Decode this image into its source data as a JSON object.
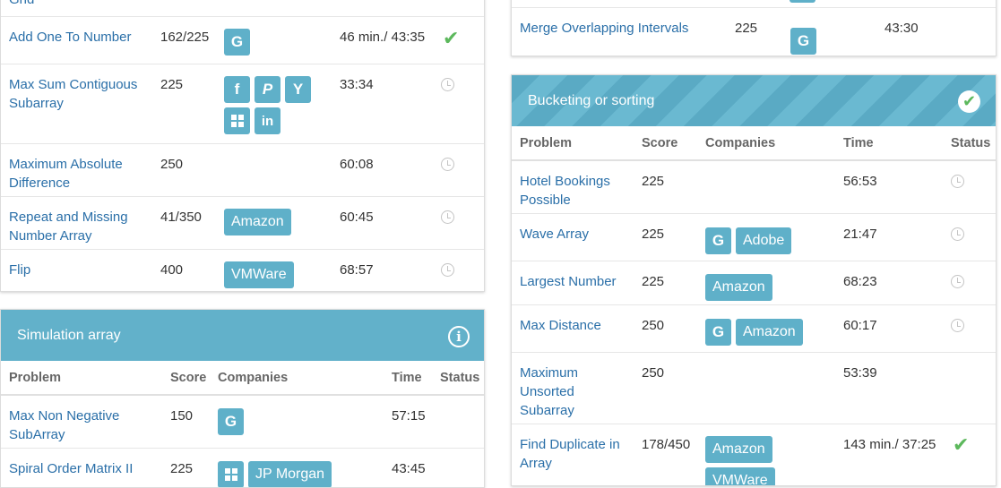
{
  "left_top": {
    "cut_text": "Grid",
    "rows": [
      {
        "problem": "Add One To Number",
        "score": "162/225",
        "companies": [
          {
            "label": "G",
            "icon": "google-icon"
          }
        ],
        "time": "46 min./ 43:35",
        "status": "solved"
      },
      {
        "problem": "Max Sum Contiguous Subarray",
        "score": "225",
        "companies": [
          {
            "label": "f",
            "icon": "facebook-icon"
          },
          {
            "label": "P",
            "icon": "paypal-icon"
          },
          {
            "label": "Y",
            "icon": "yahoo-icon"
          },
          {
            "label": "",
            "icon": "microsoft-icon"
          },
          {
            "label": "in",
            "icon": "linkedin-icon"
          }
        ],
        "time": "33:34",
        "status": "pending"
      },
      {
        "problem": "Maximum Absolute Difference",
        "score": "250",
        "companies": [],
        "time": "60:08",
        "status": "pending"
      },
      {
        "problem": "Repeat and Missing Number Array",
        "score": "41/350",
        "companies": [
          {
            "label": "Amazon",
            "icon": ""
          }
        ],
        "time": "60:45",
        "status": "pending"
      },
      {
        "problem": "Flip",
        "score": "400",
        "companies": [
          {
            "label": "VMWare",
            "icon": ""
          }
        ],
        "time": "68:57",
        "status": "pending"
      }
    ]
  },
  "simulation": {
    "title": "Simulation array",
    "headers": {
      "problem": "Problem",
      "score": "Score",
      "companies": "Companies",
      "time": "Time",
      "status": "Status"
    },
    "rows": [
      {
        "problem": "Max Non Negative SubArray",
        "score": "150",
        "companies": [
          {
            "label": "G",
            "icon": "google-icon"
          }
        ],
        "time": "57:15"
      },
      {
        "problem": "Spiral Order Matrix II",
        "score": "225",
        "companies": [
          {
            "label": "",
            "icon": "microsoft-icon"
          },
          {
            "label": "JP Morgan",
            "icon": ""
          }
        ],
        "time": "43:45"
      }
    ]
  },
  "right_top": {
    "rows": [
      {
        "problem": "Merge Overlapping Intervals",
        "score": "225",
        "companies": [
          {
            "label": "G",
            "icon": "google-icon"
          }
        ],
        "time": "43:30"
      }
    ]
  },
  "bucketing": {
    "title": "Bucketing or sorting",
    "headers": {
      "problem": "Problem",
      "score": "Score",
      "companies": "Companies",
      "time": "Time",
      "status": "Status"
    },
    "rows": [
      {
        "problem": "Hotel Bookings Possible",
        "score": "225",
        "companies": [],
        "time": "56:53",
        "status": "pending"
      },
      {
        "problem": "Wave Array",
        "score": "225",
        "companies": [
          {
            "label": "G",
            "icon": "google-icon"
          },
          {
            "label": "Adobe",
            "icon": ""
          }
        ],
        "time": "21:47",
        "status": "pending"
      },
      {
        "problem": "Largest Number",
        "score": "225",
        "companies": [
          {
            "label": "Amazon",
            "icon": ""
          }
        ],
        "time": "68:23",
        "status": "pending"
      },
      {
        "problem": "Max Distance",
        "score": "250",
        "companies": [
          {
            "label": "G",
            "icon": "google-icon"
          },
          {
            "label": "Amazon",
            "icon": ""
          }
        ],
        "time": "60:17",
        "status": "pending"
      },
      {
        "problem": "Maximum Unsorted Subarray",
        "score": "250",
        "companies": [],
        "time": "53:39",
        "status": ""
      },
      {
        "problem": "Find Duplicate in Array",
        "score": "178/450",
        "companies": [
          {
            "label": "Amazon",
            "icon": ""
          },
          {
            "label": "VMWare",
            "icon": ""
          }
        ],
        "time": "143 min./ 37:25",
        "status": "solved"
      }
    ]
  },
  "colors": {
    "accent": "#5fb0c9",
    "header": "#62b1ca",
    "link": "#2a6fa8",
    "solved": "#5cb85c"
  }
}
